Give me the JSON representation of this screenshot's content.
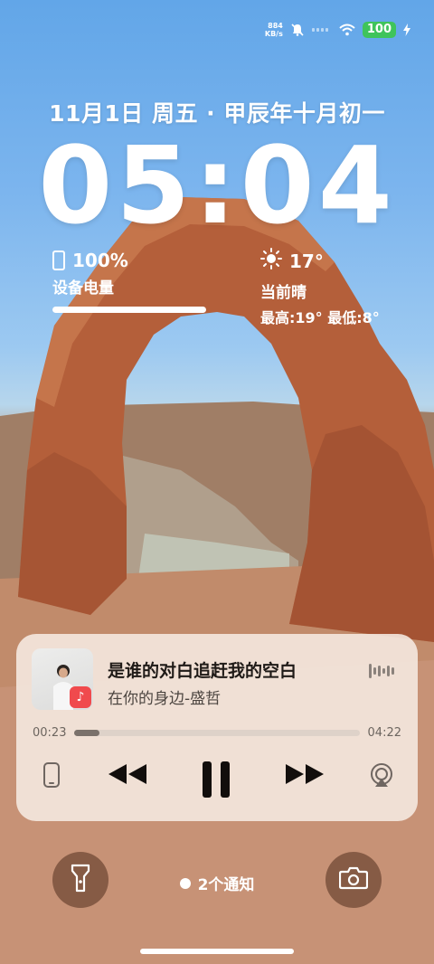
{
  "status_bar": {
    "net_speed_value": "884",
    "net_speed_unit": "KB/s",
    "battery_level": "100",
    "icons": [
      "mute-icon",
      "signal-icon",
      "wifi-icon",
      "battery-icon",
      "charging-icon"
    ]
  },
  "lockscreen": {
    "date": "11月1日 周五 · 甲辰年十月初一",
    "time": "05:04"
  },
  "battery_widget": {
    "percent": "100%",
    "label": "设备电量",
    "level": 1.0
  },
  "weather_widget": {
    "temperature": "17°",
    "condition": "当前晴",
    "range": "最高:19° 最低:8°",
    "icon": "sun-icon"
  },
  "music": {
    "title": "是谁的对白追赶我的空白",
    "artist": "在你的身边-盛哲",
    "current_time": "00:23",
    "total_time": "04:22",
    "progress": 0.088,
    "badge_glyph": "♪",
    "controls": [
      "device-icon",
      "previous-icon",
      "pause-icon",
      "next-icon",
      "airplay-icon"
    ],
    "badge_color": "#f04a4d"
  },
  "bottom": {
    "notification_text": "2个通知",
    "left_button": "flashlight-icon",
    "right_button": "camera-icon"
  }
}
